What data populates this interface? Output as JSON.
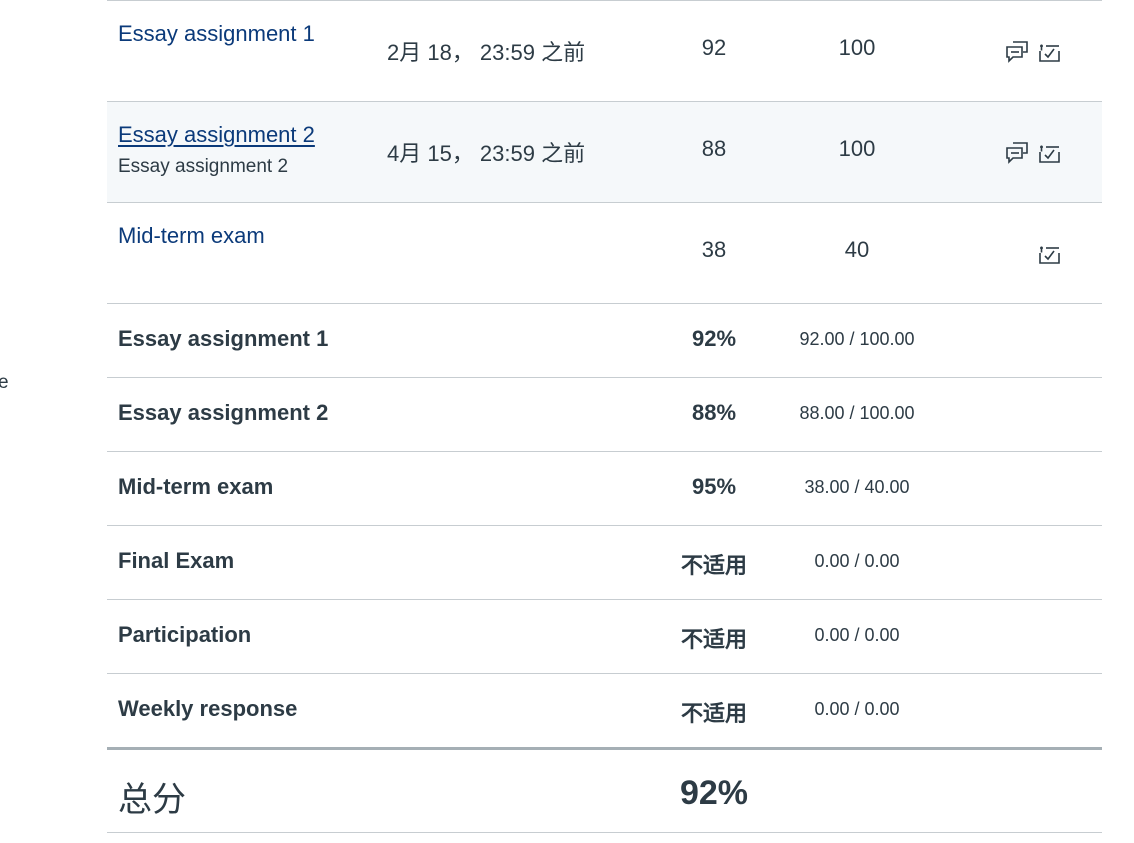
{
  "edge_text": "e",
  "assignments": [
    {
      "title": "Essay assignment 1",
      "context": "",
      "due": "2月 18， 23:59 之前",
      "score": "92",
      "possible": "100",
      "has_comments": true,
      "has_rubric": true
    },
    {
      "title": "Essay assignment 2",
      "context": "Essay assignment 2",
      "due": "4月 15， 23:59 之前",
      "score": "88",
      "possible": "100",
      "has_comments": true,
      "has_rubric": true
    },
    {
      "title": "Mid-term exam",
      "context": "",
      "due": "",
      "score": "38",
      "possible": "40",
      "has_comments": false,
      "has_rubric": true
    }
  ],
  "groups": [
    {
      "name": "Essay assignment 1",
      "percent": "92%",
      "points": "92.00 / 100.00"
    },
    {
      "name": "Essay assignment 2",
      "percent": "88%",
      "points": "88.00 / 100.00"
    },
    {
      "name": "Mid-term exam",
      "percent": "95%",
      "points": "38.00 / 40.00"
    },
    {
      "name": "Final Exam",
      "percent": "不适用",
      "points": "0.00 / 0.00"
    },
    {
      "name": "Participation",
      "percent": "不适用",
      "points": "0.00 / 0.00"
    },
    {
      "name": "Weekly response",
      "percent": "不适用",
      "points": "0.00 / 0.00"
    }
  ],
  "total": {
    "label": "总分",
    "percent": "92%"
  },
  "icons": {
    "comments": "comments-icon",
    "rubric": "rubric-icon"
  },
  "colors": {
    "link": "#0b3a7a",
    "text": "#2d3b45",
    "hover_row": "#f5f8fa",
    "border": "#c7cdd1"
  }
}
